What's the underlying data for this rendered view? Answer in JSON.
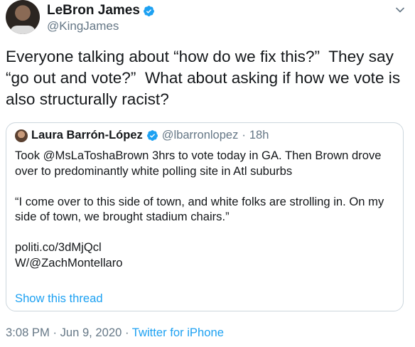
{
  "author": {
    "name": "LeBron James",
    "handle": "@KingJames"
  },
  "tweet": {
    "text": "Everyone talking about “how do we fix this?”  They say “go out and vote?”  What about asking if how we vote is also structurally racist?"
  },
  "quoted": {
    "name": "Laura Barrón-López",
    "handle": "@lbarronlopez",
    "separator": "·",
    "time": "18h",
    "text": "Took @MsLaToshaBrown 3hrs to vote today in GA. Then Brown drove over to predominantly white polling site in Atl suburbs\n\n“I come over to this side of town, and white folks are strolling in. On my side of town, we brought stadium chairs.”\n\npoliti.co/3dMjQcl\nW/@ZachMontellaro",
    "show_thread": "Show this thread"
  },
  "meta": {
    "time": "3:08 PM",
    "dot1": "·",
    "date": "Jun 9, 2020",
    "dot2": "·",
    "source": "Twitter for iPhone"
  },
  "colors": {
    "accent": "#1da1f2",
    "muted": "#657786",
    "text": "#14171a",
    "border": "#ccd6dd"
  },
  "icons": {
    "verified": "verified-badge-icon",
    "caret": "chevron-down-icon"
  }
}
